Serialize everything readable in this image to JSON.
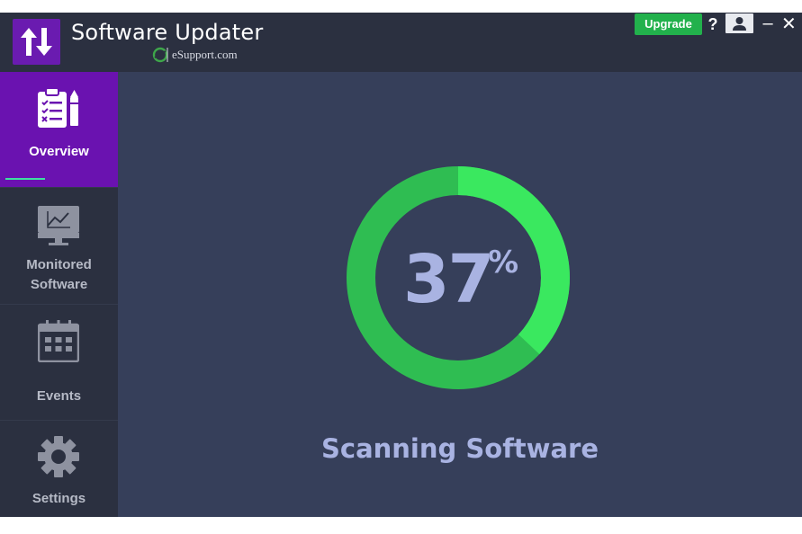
{
  "window": {
    "title": "Software Updater",
    "brand": "eSupport.com",
    "upgrade_label": "Upgrade",
    "help_label": "?",
    "minimize_label": "–",
    "close_label": "✕"
  },
  "sidebar": {
    "items": [
      {
        "label": "Overview",
        "icon": "clipboard-checklist-icon",
        "active": true
      },
      {
        "label": "Monitored Software",
        "line1": "Monitored",
        "line2": "Software",
        "icon": "monitor-chart-icon",
        "active": false
      },
      {
        "label": "Events",
        "icon": "calendar-icon",
        "active": false
      },
      {
        "label": "Settings",
        "icon": "gear-icon",
        "active": false
      }
    ]
  },
  "scan": {
    "progress_value": "37",
    "progress_symbol": "%",
    "progress_fraction": 0.37,
    "status": "Scanning Software"
  },
  "colors": {
    "accent_purple": "#6a12b0",
    "progress_green": "#3ae85f",
    "track_green": "#2fbd52",
    "upgrade_green": "#22b14c",
    "main_bg": "#363f5a",
    "sidebar_bg": "#2b3040",
    "text_lavender": "#a9b3e2"
  }
}
